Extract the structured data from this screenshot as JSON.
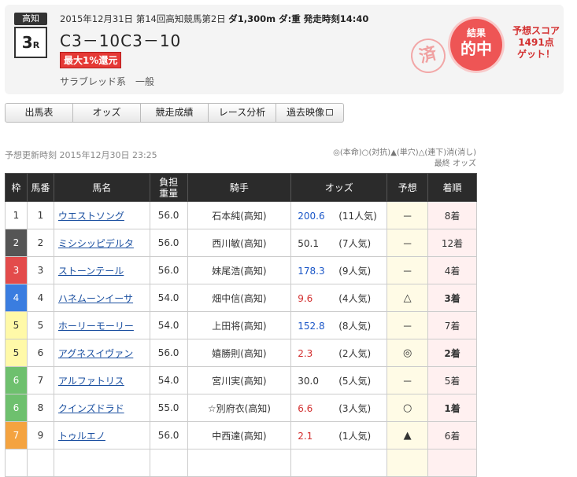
{
  "race": {
    "venue": "高知",
    "number": "3",
    "number_suffix": "R",
    "info": "2015年12月31日 第14回高知競馬第2日",
    "conditions": "ダ1,300m ダ:重 発走時刻14:40",
    "name": "C3－10C3－10",
    "refund_prefix": "最大",
    "refund_value": "1%還元",
    "category": "サラブレッド系　一般"
  },
  "result": {
    "stamp": "済",
    "label_top": "結果",
    "label_main": "的中",
    "score_line1": "予想スコア",
    "score_line2": "1491点",
    "score_line3": "ゲット！"
  },
  "tabs": [
    "出馬表",
    "オッズ",
    "競走成績",
    "レース分析",
    "過去映像"
  ],
  "updated": "予想更新時刻 2015年12月30日 23:25",
  "legend": {
    "line1": "◎(本命)○(対抗)▲(単穴)△(連下)消(消し)",
    "line2": "最終 オッズ"
  },
  "table": {
    "headers": {
      "waku": "枠",
      "umaban": "馬番",
      "name": "馬名",
      "weight_l1": "負担",
      "weight_l2": "重量",
      "jockey": "騎手",
      "odds": "オッズ",
      "prediction": "予想",
      "finish": "着順"
    },
    "rows": [
      {
        "waku": "1",
        "umaban": "1",
        "name": "ウエストソング",
        "weight": "56.0",
        "jockey": "石本純(高知)",
        "odds": "200.6",
        "odds_color": "#1a56c7",
        "popularity": "(11人気)",
        "prediction": "－",
        "finish": "8着"
      },
      {
        "waku": "2",
        "umaban": "2",
        "name": "ミシシッピデルタ",
        "weight": "56.0",
        "jockey": "西川敏(高知)",
        "odds": "50.1",
        "odds_color": "#333333",
        "popularity": "(7人気)",
        "prediction": "－",
        "finish": "12着"
      },
      {
        "waku": "3",
        "umaban": "3",
        "name": "ストーンテール",
        "weight": "56.0",
        "jockey": "妹尾浩(高知)",
        "odds": "178.3",
        "odds_color": "#1a56c7",
        "popularity": "(9人気)",
        "prediction": "－",
        "finish": "4着"
      },
      {
        "waku": "4",
        "umaban": "4",
        "name": "ハネムーンイーサ",
        "weight": "54.0",
        "jockey": "畑中信(高知)",
        "odds": "9.6",
        "odds_color": "#d32f2f",
        "popularity": "(4人気)",
        "prediction": "△",
        "finish": "3着"
      },
      {
        "waku": "5",
        "umaban": "5",
        "name": "ホーリーモーリー",
        "weight": "54.0",
        "jockey": "上田将(高知)",
        "odds": "152.8",
        "odds_color": "#1a56c7",
        "popularity": "(8人気)",
        "prediction": "－",
        "finish": "7着"
      },
      {
        "waku": "5",
        "umaban": "6",
        "name": "アグネスイヴァン",
        "weight": "56.0",
        "jockey": "嬉勝則(高知)",
        "odds": "2.3",
        "odds_color": "#d32f2f",
        "popularity": "(2人気)",
        "prediction": "◎",
        "finish": "2着"
      },
      {
        "waku": "6",
        "umaban": "7",
        "name": "アルファトリス",
        "weight": "54.0",
        "jockey": "宮川実(高知)",
        "odds": "30.0",
        "odds_color": "#333333",
        "popularity": "(5人気)",
        "prediction": "－",
        "finish": "5着"
      },
      {
        "waku": "6",
        "umaban": "8",
        "name": "クインズドラド",
        "weight": "55.0",
        "jockey": "☆別府衣(高知)",
        "odds": "6.6",
        "odds_color": "#d32f2f",
        "popularity": "(3人気)",
        "prediction": "○",
        "finish": "1着"
      },
      {
        "waku": "7",
        "umaban": "9",
        "name": "トゥルエノ",
        "weight": "56.0",
        "jockey": "中西達(高知)",
        "odds": "2.1",
        "odds_color": "#d32f2f",
        "popularity": "(1人気)",
        "prediction": "▲",
        "finish": "6着"
      },
      {
        "waku": "",
        "umaban": "",
        "name": "",
        "weight": "",
        "jockey": "",
        "odds": "",
        "odds_color": "#333333",
        "popularity": "",
        "prediction": "",
        "finish": ""
      }
    ]
  }
}
